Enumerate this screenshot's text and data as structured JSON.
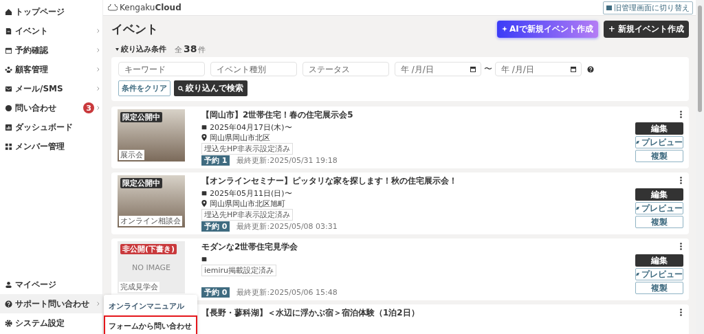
{
  "sidebar": {
    "items": [
      {
        "label": "トップページ",
        "chevron": false,
        "expanded": false
      },
      {
        "label": "イベント",
        "chevron": true,
        "expanded": false
      },
      {
        "label": "予約確認",
        "chevron": true,
        "expanded": false
      },
      {
        "label": "顧客管理",
        "chevron": true,
        "expanded": false
      },
      {
        "label": "メール/SMS",
        "chevron": true,
        "expanded": false
      },
      {
        "label": "問い合わせ",
        "chevron": true,
        "expanded": false,
        "badge": "3"
      },
      {
        "label": "ダッシュボード",
        "chevron": false,
        "expanded": false
      },
      {
        "label": "メンバー管理",
        "chevron": false,
        "expanded": false
      }
    ],
    "bottom_items": [
      {
        "label": "マイページ",
        "chevron": false,
        "expanded": false
      },
      {
        "label": "サポート問い合わせ",
        "chevron": true,
        "expanded": true
      },
      {
        "label": "システム設定",
        "chevron": false,
        "expanded": false
      }
    ]
  },
  "submenu": {
    "items": [
      {
        "label": "オンラインマニュアル",
        "highlighted": false
      },
      {
        "label": "フォームから問い合わせ",
        "highlighted": true
      }
    ]
  },
  "header": {
    "logo": "Kengaku**Cloud**",
    "switch_button": "旧管理画面に切り替え"
  },
  "page": {
    "title": "イベント",
    "ai_button": "AIで新規イベント作成",
    "new_button": "+ 新規イベント作成"
  },
  "filter": {
    "toggle": "絞り込み条件",
    "total_prefix": "全",
    "total": "38",
    "total_suffix": "件",
    "fields": [
      {
        "placeholder": "キーワード"
      },
      {
        "placeholder": "イベント種別"
      },
      {
        "placeholder": "ステータス"
      }
    ],
    "date_from": {
      "placeholder": "年 /月/日"
    },
    "date_separator": "〜",
    "date_to": {
      "placeholder": "年 /月/日"
    },
    "clear_button": "条件をクリア",
    "search_button": "絞り込んで検索"
  },
  "events": [
    {
      "status": "限定公開中",
      "color": "#333333",
      "category": "展示会",
      "title": "【岡山市】2世帯住宅！春の住宅展示会5",
      "date": "2025年04月17日(木)〜",
      "location": "岡山県岡山市北区",
      "tag": "埋込先HP非表示設定済み",
      "reservations": "予約 1",
      "updated": "最終更新:2025/05/31 19:18",
      "actions": [
        "編集",
        "プレビュー",
        "複製"
      ]
    },
    {
      "status": "限定公開中",
      "color": "#333333",
      "category": "オンライン相談会",
      "title": "【オンラインセミナー】ピッタリな家を探します！秋の住宅展示会！",
      "date": "2025年05月11日(日)〜",
      "location": "岡山県岡山市北区旭町",
      "tag": "埋込先HP非表示設定済み",
      "reservations": "予約 0",
      "updated": "最終更新:2025/05/08 03:31",
      "actions": [
        "編集",
        "プレビュー",
        "複製"
      ]
    },
    {
      "no_image": "NO IMAGE",
      "status": "非公開(下書き)",
      "color": "#c9393c",
      "category": "完成見学会",
      "title": "モダンな2世帯住宅見学会",
      "tag": "iemiru掲載設定済み",
      "reservations": "予約 0",
      "updated": "最終更新:2025/05/06 15:48",
      "actions": [
        "編集",
        "プレビュー",
        "複製"
      ]
    },
    {
      "title": "【長野・蓼科湖】＜水辺に浮かぶ宿＞宿泊体験（1泊2日）"
    }
  ]
}
